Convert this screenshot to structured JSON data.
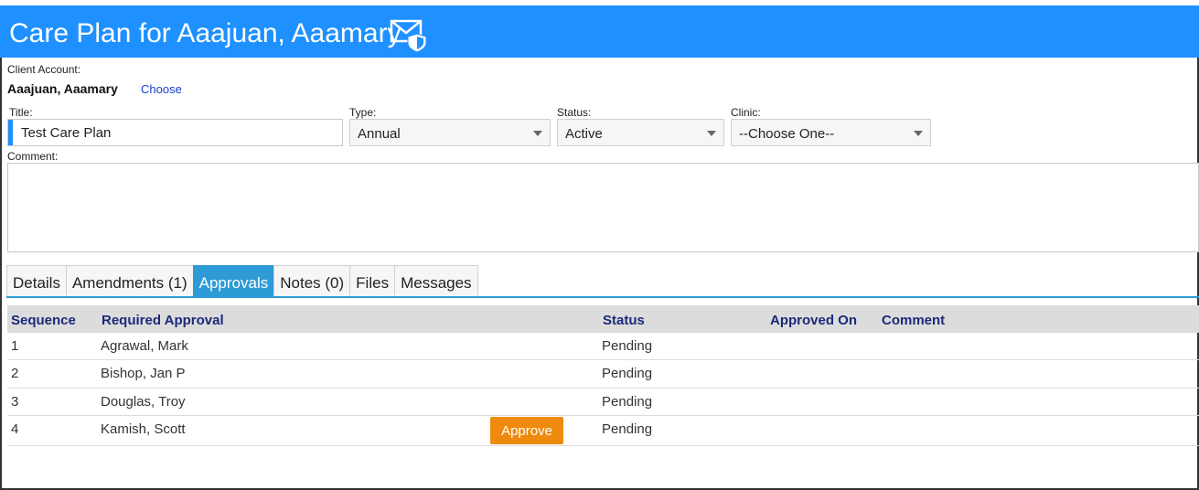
{
  "header": {
    "title": "Care Plan for Aaajuan, Aaamary",
    "icon": "secure-mail-icon"
  },
  "client": {
    "label": "Client Account:",
    "name": "Aaajuan, Aaamary",
    "choose_link": "Choose"
  },
  "form": {
    "title_label": "Title:",
    "title_value": "Test Care Plan",
    "type_label": "Type:",
    "type_value": "Annual",
    "status_label": "Status:",
    "status_value": "Active",
    "clinic_label": "Clinic:",
    "clinic_value": "--Choose One--",
    "comment_label": "Comment:"
  },
  "tabs": [
    {
      "label": "Details"
    },
    {
      "label": "Amendments (1)"
    },
    {
      "label": "Approvals",
      "active": true
    },
    {
      "label": "Notes (0)"
    },
    {
      "label": "Files"
    },
    {
      "label": "Messages"
    }
  ],
  "approvals": {
    "columns": [
      "Sequence",
      "Required Approval",
      "Status",
      "Approved On",
      "Comment"
    ],
    "rows": [
      {
        "sequence": "1",
        "approver": "Agrawal, Mark",
        "status": "Pending"
      },
      {
        "sequence": "2",
        "approver": "Bishop, Jan P",
        "status": "Pending"
      },
      {
        "sequence": "3",
        "approver": "Douglas, Troy",
        "status": "Pending"
      },
      {
        "sequence": "4",
        "approver": "Kamish, Scott",
        "status": "Pending"
      }
    ],
    "approve_button": "Approve"
  },
  "colors": {
    "header": "#1e90ff",
    "tab_active": "#2d9bd6",
    "approve": "#ee8a0e",
    "column_header_text": "#1a2a7a"
  }
}
